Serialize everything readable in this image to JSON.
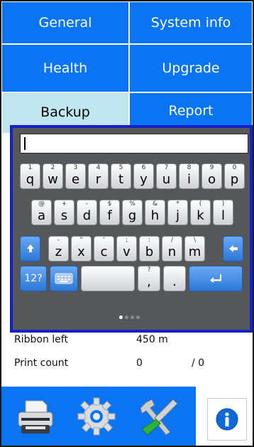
{
  "tabs": {
    "general": "General",
    "system_info": "System info",
    "health": "Health",
    "upgrade": "Upgrade",
    "backup": "Backup",
    "report": "Report"
  },
  "keyboard": {
    "input_value": "",
    "row1": [
      {
        "sym": "1",
        "key": "q"
      },
      {
        "sym": "2",
        "key": "w"
      },
      {
        "sym": "3",
        "key": "e"
      },
      {
        "sym": "4",
        "key": "r"
      },
      {
        "sym": "5",
        "key": "t"
      },
      {
        "sym": "6",
        "key": "y"
      },
      {
        "sym": "7",
        "key": "u"
      },
      {
        "sym": "8",
        "key": "i"
      },
      {
        "sym": "9",
        "key": "o"
      },
      {
        "sym": "0",
        "key": "p"
      }
    ],
    "row2": [
      {
        "sym": "@",
        "key": "a"
      },
      {
        "sym": "+",
        "key": "s"
      },
      {
        "sym": "-",
        "key": "d"
      },
      {
        "sym": "$",
        "key": "f"
      },
      {
        "sym": "%",
        "key": "g"
      },
      {
        "sym": "&",
        "key": "h"
      },
      {
        "sym": "*",
        "key": "j"
      },
      {
        "sym": "(",
        "key": "k"
      },
      {
        "sym": ")",
        "key": "l"
      }
    ],
    "row3": [
      {
        "sym": "-",
        "key": "z"
      },
      {
        "sym": "\"",
        "key": "x"
      },
      {
        "sym": "'",
        "key": "c"
      },
      {
        "sym": ";",
        "key": "v"
      },
      {
        "sym": ":",
        "key": "b"
      },
      {
        "sym": "/",
        "key": "n"
      },
      {
        "sym": "\\",
        "key": "m"
      }
    ],
    "num_label": "12?",
    "comma": {
      "sym": "?",
      "key": ","
    },
    "period": {
      "sym": "",
      "key": "."
    },
    "page_dots": 4
  },
  "info": {
    "ribbon_label": "Ribbon left",
    "ribbon_value": "450 m",
    "print_label": "Print count",
    "print_value": "0",
    "print_total": "/ 0"
  },
  "colors": {
    "accent": "#0a74f2",
    "active_tab": "#bfe6ef",
    "keyboard_border": "#1420c8"
  }
}
